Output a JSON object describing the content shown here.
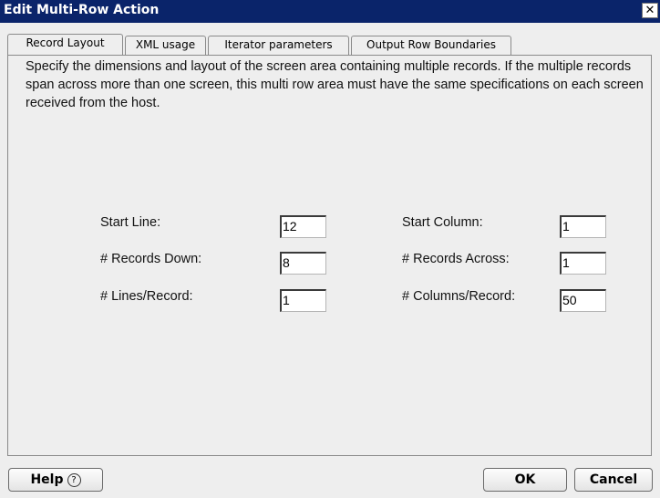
{
  "window": {
    "title": "Edit Multi-Row Action",
    "close_glyph": "✕"
  },
  "tabs": [
    {
      "label": "Record Layout",
      "active": true
    },
    {
      "label": "XML usage",
      "active": false
    },
    {
      "label": "Iterator parameters",
      "active": false
    },
    {
      "label": "Output Row Boundaries",
      "active": false
    }
  ],
  "description": "Specify the dimensions and layout of the screen area containing multiple records. If the multiple records span across more than one screen, this multi row area must have the same specifications on each screen received from the host.",
  "fields": {
    "start_line": {
      "label": "Start Line:",
      "value": "12"
    },
    "records_down": {
      "label": "# Records Down:",
      "value": "8"
    },
    "lines_per_record": {
      "label": "# Lines/Record:",
      "value": "1"
    },
    "start_column": {
      "label": "Start Column:",
      "value": "1"
    },
    "records_across": {
      "label": "# Records Across:",
      "value": "1"
    },
    "columns_per_record": {
      "label": "# Columns/Record:",
      "value": "50"
    }
  },
  "buttons": {
    "help": "Help",
    "help_icon_glyph": "?",
    "ok": "OK",
    "cancel": "Cancel"
  },
  "colors": {
    "titlebar": "#0a246a",
    "dialog_bg": "#eeeeee"
  }
}
